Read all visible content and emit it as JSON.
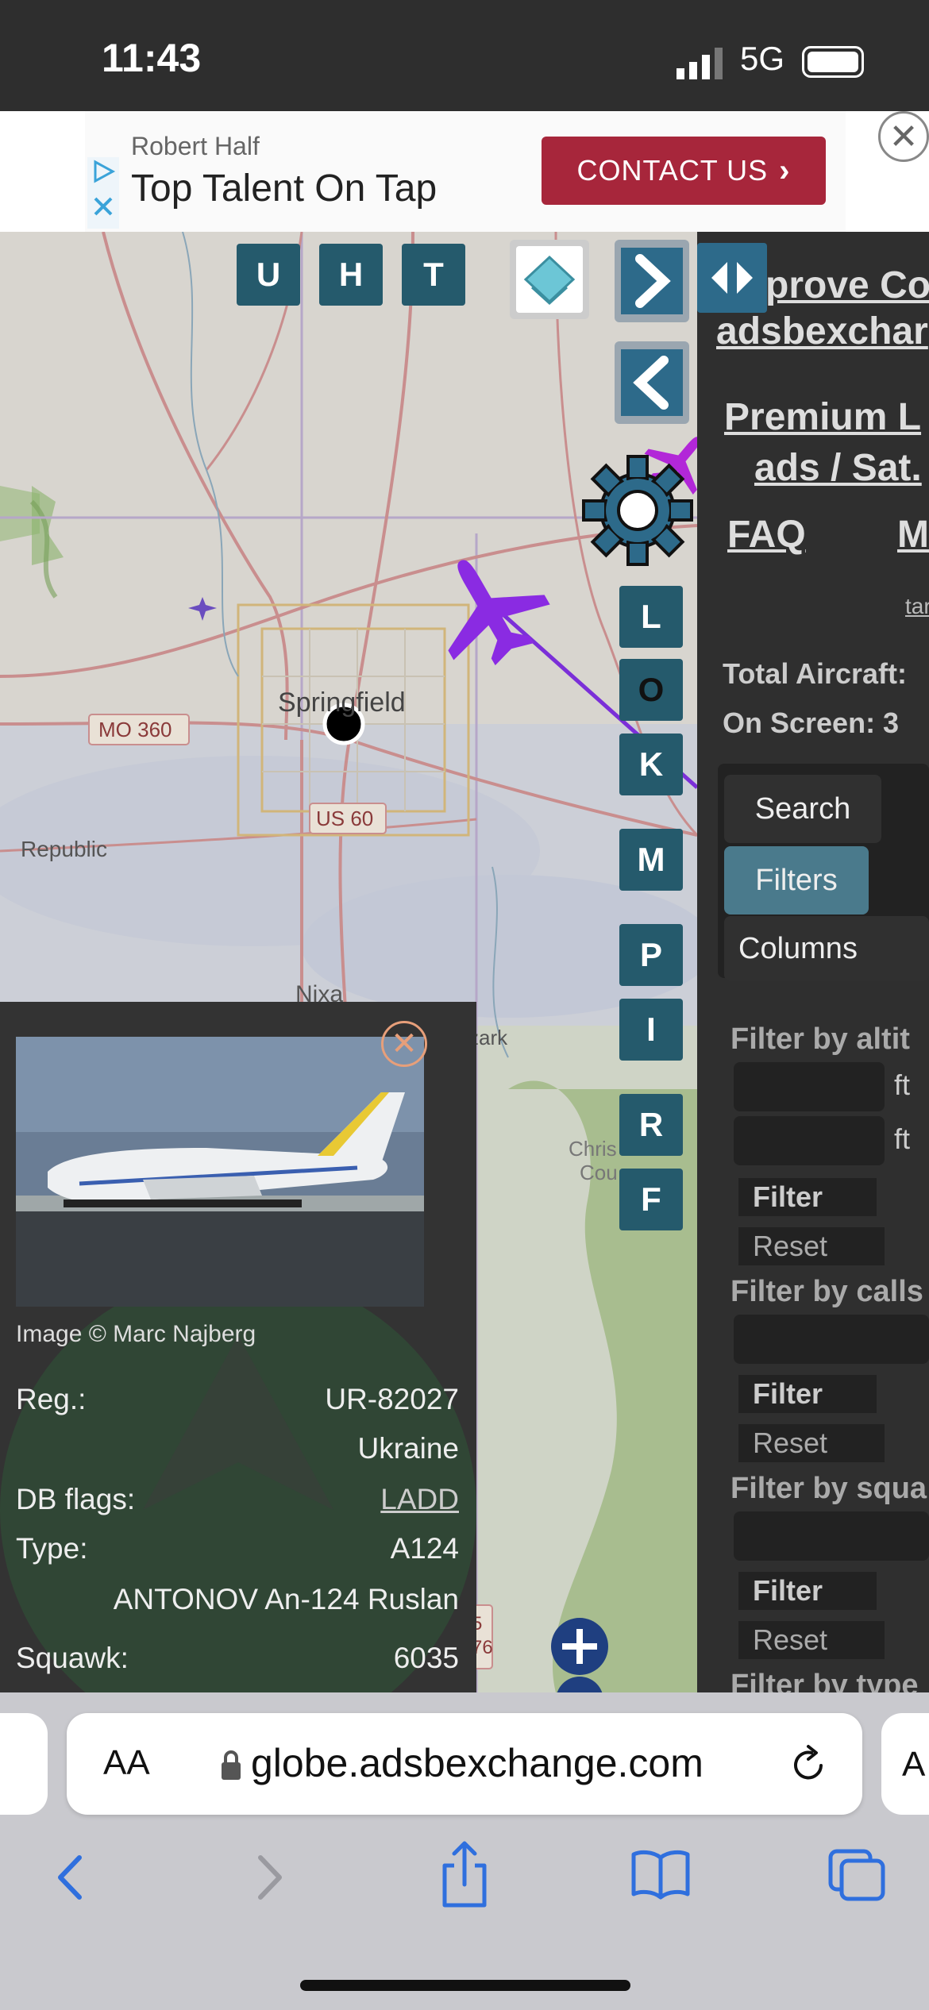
{
  "status_bar": {
    "time": "11:43",
    "network": "5G"
  },
  "ad": {
    "advertiser": "Robert Half",
    "headline": "Top Talent On Tap",
    "cta_label": "CONTACT US"
  },
  "map": {
    "buttons_top": [
      "U",
      "H",
      "T"
    ],
    "side_buttons": [
      "L",
      "O",
      "K",
      "M",
      "P",
      "I",
      "R",
      "F"
    ],
    "labels": {
      "city": "Springfield",
      "mo360": "MO 360",
      "us60": "US 60",
      "republic": "Republic",
      "nixa": "Nixa",
      "ozark": "zark",
      "christian_1": "Chris",
      "christian_2": "Cou",
      "hwy_1": "5",
      "hwy_2": "76"
    }
  },
  "aircraft_info": {
    "photo_credit": "Image © Marc Najberg",
    "rows": [
      {
        "label": "Reg.:",
        "value": "UR-82027"
      },
      {
        "label": "",
        "value": "Ukraine"
      },
      {
        "label": "DB flags:",
        "value": "LADD"
      },
      {
        "label": "Type:",
        "value": "A124"
      },
      {
        "label": "",
        "value": "ANTONOV An-124 Ruslan"
      },
      {
        "label": "Squawk:",
        "value": "6035"
      }
    ]
  },
  "sidebar": {
    "improve_line1": "Improve Co",
    "improve_line2": "adsbexchar",
    "premium_line1": "Premium L",
    "premium_line2": "ads / Sat.",
    "faq": "FAQ",
    "m_link": "M",
    "tar": "tar",
    "total_aircraft": "Total Aircraft:",
    "on_screen": "On Screen: 3",
    "tabs": [
      "Search",
      "Filters",
      "Columns"
    ],
    "filters": [
      {
        "title": "Filter by altit",
        "units": [
          "ft",
          "ft"
        ],
        "filter_label": "Filter",
        "reset_label": "Reset"
      },
      {
        "title": "Filter by calls",
        "filter_label": "Filter",
        "reset_label": "Reset"
      },
      {
        "title": "Filter by squa",
        "filter_label": "Filter",
        "reset_label": "Reset"
      },
      {
        "title": "Filter by type"
      }
    ]
  },
  "browser": {
    "aa_label": "AA",
    "url": "globe.adsbexchange.com"
  },
  "colors": {
    "map_button": "#255a6c",
    "aircraft_selected": "#8a2be2",
    "aircraft_other": "#b227d8",
    "ad_cta": "#a7263b",
    "sidebar_bg": "#2f2f2f",
    "active_tab": "#4a7a8c"
  }
}
